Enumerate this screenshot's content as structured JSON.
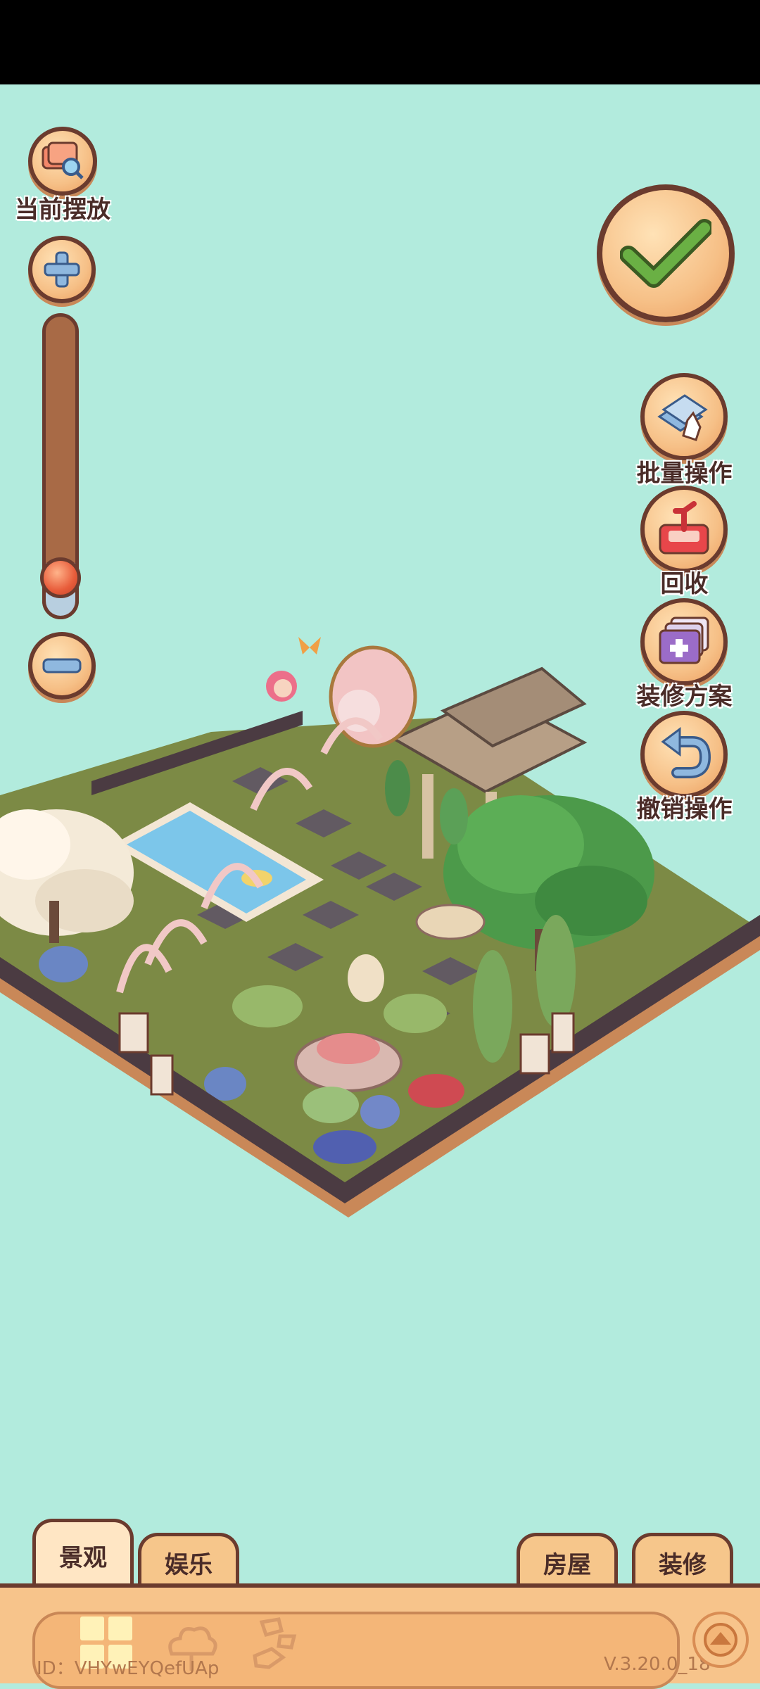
{
  "left_tools": {
    "current_placement_label": "当前摆放",
    "current_placement_icon": "search-box-icon",
    "zoom_in_icon": "plus-icon",
    "zoom_out_icon": "minus-icon",
    "zoom_level": 0.1
  },
  "right_tools": {
    "confirm_icon": "checkmark-icon",
    "batch_label": "批量操作",
    "batch_icon": "hand-tap-icon",
    "recycle_label": "回收",
    "recycle_icon": "recycle-bin-icon",
    "plan_label": "装修方案",
    "plan_icon": "add-plan-icon",
    "undo_label": "撤销操作",
    "undo_icon": "undo-icon"
  },
  "tabs_left": [
    "景观",
    "娱乐"
  ],
  "tabs_right": [
    "房屋",
    "装修"
  ],
  "active_tab": "景观",
  "category_icons": [
    "grid-icon",
    "tree-icon",
    "stone-icon"
  ],
  "footer": {
    "id_text": "ID：VHYwEYQefUAp",
    "version_text": "V.3.20.0_18"
  },
  "colors": {
    "background": "#b2ebdd",
    "outline": "#6b3b2e",
    "panel": "#f7c48b",
    "confirm_check": "#5aa83c"
  }
}
